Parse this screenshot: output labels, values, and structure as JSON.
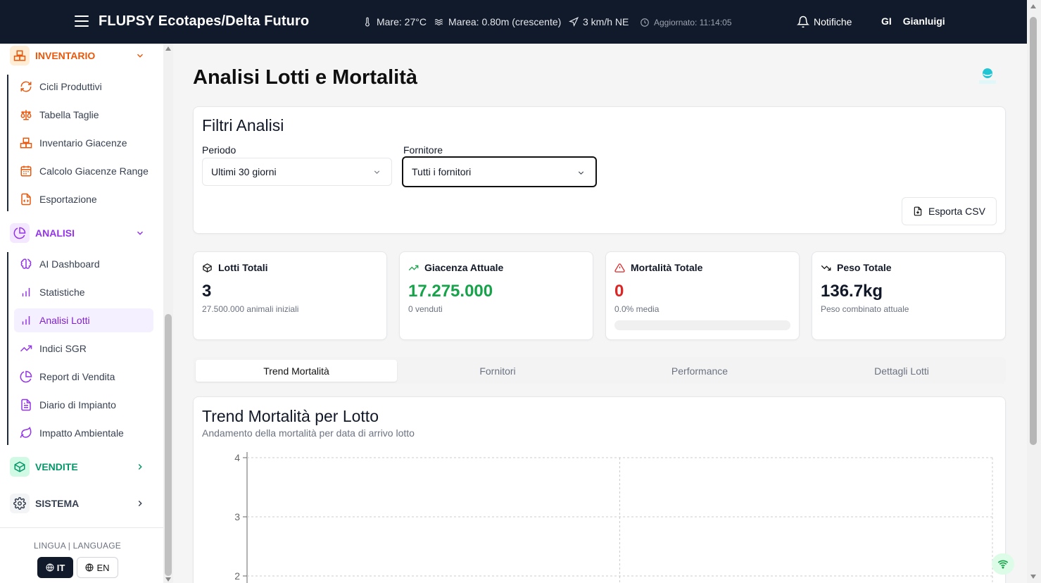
{
  "header": {
    "title": "FLUPSY Ecotapes/Delta Futuro",
    "sea_temp": "Mare: 27°C",
    "tide": "Marea: 0.80m (crescente)",
    "wind": "3 km/h NE",
    "updated": "Aggiornato: 11:14:05",
    "notifications": "Notifiche",
    "user_initials": "GI",
    "user_name": "Gianluigi"
  },
  "sidebar": {
    "inventario": {
      "label": "INVENTARIO",
      "color": "#ea580c",
      "items": [
        "Cicli Produttivi",
        "Tabella Taglie",
        "Inventario Giacenze",
        "Calcolo Giacenze Range",
        "Esportazione"
      ]
    },
    "analisi": {
      "label": "ANALISI",
      "color": "#9333ea",
      "items": [
        "AI Dashboard",
        "Statistiche",
        "Analisi Lotti",
        "Indici SGR",
        "Report di Vendita",
        "Diario di Impianto",
        "Impatto Ambientale"
      ],
      "active": "Analisi Lotti"
    },
    "vendite": {
      "label": "VENDITE",
      "color": "#059669"
    },
    "sistema": {
      "label": "SISTEMA",
      "color": "#374151"
    },
    "language": {
      "title": "LINGUA | LANGUAGE",
      "it": "IT",
      "en": "EN",
      "selected": "IT"
    }
  },
  "main": {
    "title": "Analisi Lotti e Mortalità",
    "filters": {
      "title": "Filtri Analisi",
      "period_label": "Periodo",
      "period_value": "Ultimi 30 giorni",
      "supplier_label": "Fornitore",
      "supplier_value": "Tutti i fornitori",
      "export": "Esporta CSV"
    },
    "stats": {
      "lots": {
        "label": "Lotti Totali",
        "value": "3",
        "sub": "27.500.000 animali iniziali"
      },
      "stock": {
        "label": "Giacenza Attuale",
        "value": "17.275.000",
        "sub": "0 venduti",
        "color": "#16a34a"
      },
      "mortality": {
        "label": "Mortalità Totale",
        "value": "0",
        "sub": "0.0% media",
        "color": "#dc2626",
        "progress": 0
      },
      "weight": {
        "label": "Peso Totale",
        "value": "136.7kg",
        "sub": "Peso combinato attuale"
      }
    },
    "tabs": [
      "Trend Mortalità",
      "Fornitori",
      "Performance",
      "Dettagli Lotti"
    ],
    "active_tab": "Trend Mortalità",
    "chart": {
      "title": "Trend Mortalità per Lotto",
      "subtitle": "Andamento della mortalità per data di arrivo lotto"
    }
  },
  "chart_data": {
    "type": "line",
    "title": "Trend Mortalità per Lotto",
    "subtitle": "Andamento della mortalità per data di arrivo lotto",
    "y_ticks_visible": [
      4,
      3,
      2
    ],
    "grid": true,
    "series": []
  }
}
